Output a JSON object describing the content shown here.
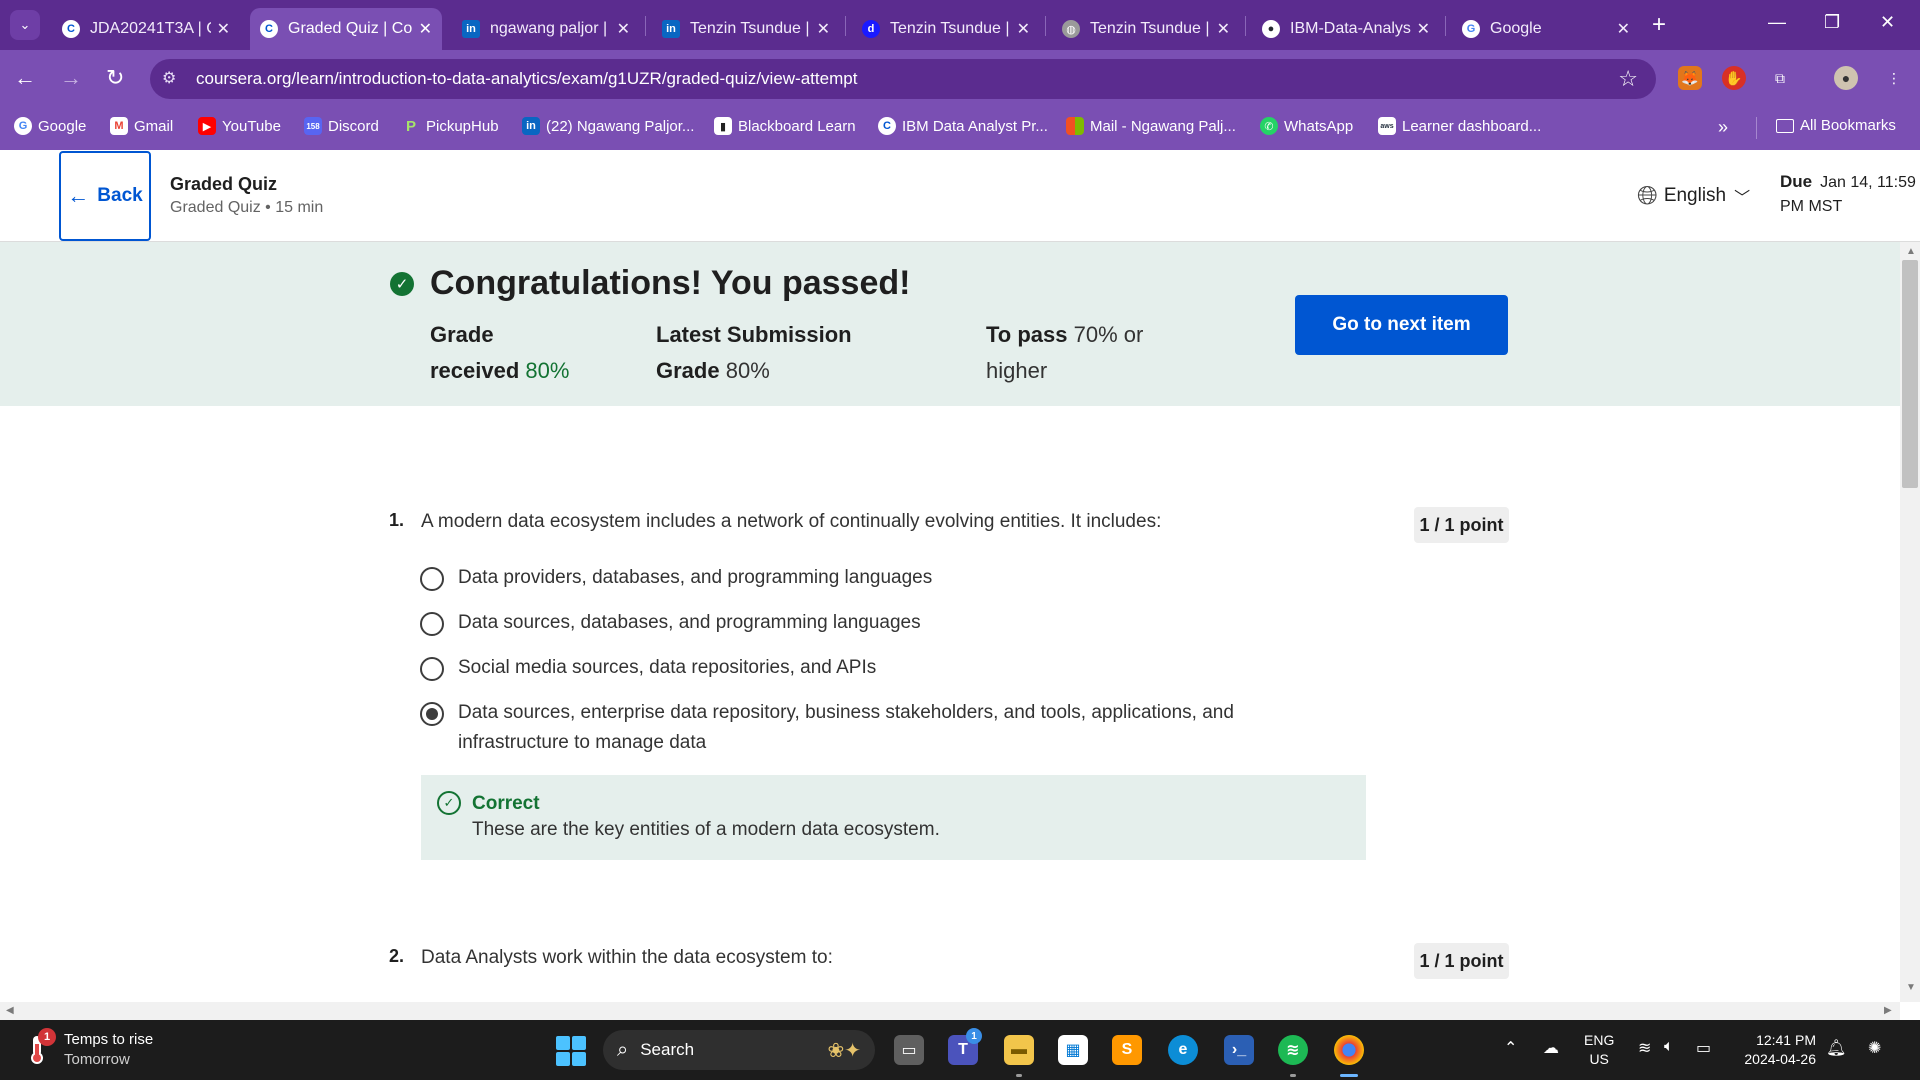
{
  "browser": {
    "tabs": [
      {
        "label": "JDA20241T3A | C",
        "favicon": "C",
        "favicon_color": "#0056d2",
        "active": false
      },
      {
        "label": "Graded Quiz | Co",
        "favicon": "C",
        "favicon_color": "#0056d2",
        "active": true
      },
      {
        "label": "ngawang paljor |",
        "favicon": "in",
        "favicon_color": "#0a66c2",
        "active": false
      },
      {
        "label": "Tenzin Tsundue |",
        "favicon": "in",
        "favicon_color": "#0a66c2",
        "active": false
      },
      {
        "label": "Tenzin Tsundue |",
        "favicon": "d",
        "favicon_color": "#1a1aff",
        "active": false
      },
      {
        "label": "Tenzin Tsundue |",
        "favicon": "◍",
        "favicon_color": "#9a9a9a",
        "active": false
      },
      {
        "label": "IBM-Data-Analys",
        "favicon": "●",
        "favicon_color": "#24292f",
        "active": false
      },
      {
        "label": "Google",
        "favicon": "G",
        "favicon_color": "#ffffff",
        "active": false
      }
    ],
    "url": "coursera.org/learn/introduction-to-data-analytics/exam/g1UZR/graded-quiz/view-attempt",
    "bookmarks": [
      {
        "label": "Google",
        "icon": "G",
        "color": "#ffffff"
      },
      {
        "label": "Gmail",
        "icon": "M",
        "color": "#ea4335"
      },
      {
        "label": "YouTube",
        "icon": "▶",
        "color": "#ff0000"
      },
      {
        "label": "Discord",
        "icon": "158",
        "color": "#5865f2"
      },
      {
        "label": "PickupHub",
        "icon": "P",
        "color": "#7cc242"
      },
      {
        "label": "(22) Ngawang Paljor...",
        "icon": "in",
        "color": "#0a66c2"
      },
      {
        "label": "Blackboard Learn",
        "icon": "▮",
        "color": "#222222"
      },
      {
        "label": "IBM Data Analyst Pr...",
        "icon": "C",
        "color": "#0056d2"
      },
      {
        "label": "Mail - Ngawang Palj...",
        "icon": "■",
        "color": "#f25022"
      },
      {
        "label": "WhatsApp",
        "icon": "✆",
        "color": "#25d366"
      },
      {
        "label": "Learner dashboard...",
        "icon": "aws",
        "color": "#232f3e"
      }
    ],
    "all_bookmarks": "All Bookmarks"
  },
  "header": {
    "back_label": "Back",
    "title": "Graded Quiz",
    "subtitle": "Graded Quiz • 15 min",
    "language": "English",
    "due_label": "Due",
    "due_line1": "Jan 14, 11:59",
    "due_line2": "PM MST"
  },
  "result": {
    "title": "Congratulations! You passed!",
    "grade_label_1": "Grade",
    "grade_label_2": "received",
    "grade_value": "80%",
    "latest_label_1": "Latest Submission",
    "latest_label_2": "Grade",
    "latest_value": "80%",
    "pass_label": "To pass",
    "pass_value_1": "70% or",
    "pass_value_2": "higher",
    "next_button": "Go to next item"
  },
  "questions": [
    {
      "number": "1.",
      "text": "A modern data ecosystem includes a network of continually evolving entities. It includes:",
      "points": "1 / 1 point",
      "options": [
        "Data providers, databases, and programming languages",
        "Data sources, databases, and programming languages",
        "Social media sources, data repositories, and APIs",
        "Data sources, enterprise data repository, business stakeholders, and tools, applications, and infrastructure to manage data"
      ],
      "selected_index": 3,
      "feedback_title": "Correct",
      "feedback_text": "These are the key entities of a modern data ecosystem."
    },
    {
      "number": "2.",
      "text": "Data Analysts work within the data ecosystem to:",
      "points": "1 / 1 point"
    }
  ],
  "taskbar": {
    "weather_title": "Temps to rise",
    "weather_sub": "Tomorrow",
    "weather_badge": "1",
    "search_placeholder": "Search",
    "teams_badge": "1",
    "lang_1": "ENG",
    "lang_2": "US",
    "time": "12:41 PM",
    "date": "2024-04-26"
  },
  "colors": {
    "tabstrip": "#5b2c8f",
    "toolbar": "#7a4fb3",
    "accent_blue": "#0056d2",
    "success_green": "#137333",
    "banner_bg": "#e5efec"
  }
}
